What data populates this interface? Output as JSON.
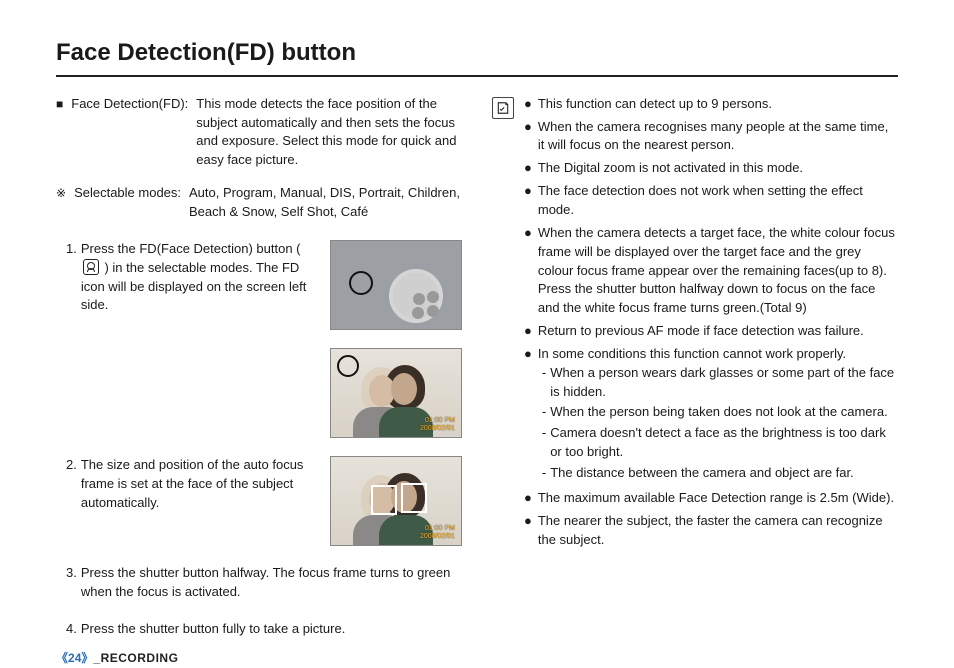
{
  "title": "Face Detection(FD) button",
  "intro": {
    "bullet": "■",
    "label": "Face Detection(FD):",
    "text": "This mode detects the face position of the subject automatically and then sets the focus and exposure. Select this mode for quick and easy face picture."
  },
  "modes": {
    "symbol": "※",
    "label": "Selectable modes:",
    "text": "Auto, Program, Manual, DIS, Portrait, Children, Beach & Snow, Self Shot, Café"
  },
  "steps": [
    {
      "num": "1.",
      "text_pre": "Press the FD(Face Detection) button ( ",
      "text_post": " ) in the selectable modes. The FD icon will be displayed on the screen left side.",
      "img_type": "camera"
    },
    {
      "num": "",
      "text_pre": "",
      "text_post": "",
      "img_type": "photo1"
    },
    {
      "num": "2.",
      "text_pre": "The size and position of the auto focus frame is set at the face of the subject automatically.",
      "text_post": "",
      "img_type": "photo2"
    },
    {
      "num": "3.",
      "text_pre": "Press the shutter button halfway. The focus frame turns to green when the focus is activated.",
      "text_post": "",
      "img_type": "none"
    },
    {
      "num": "4.",
      "text_pre": "Press the shutter button fully to take a picture.",
      "text_post": "",
      "img_type": "none"
    }
  ],
  "timestamp_line1": "01:00 PM",
  "timestamp_line2": "2008/02/01",
  "notes": [
    {
      "text": "This function can detect up to 9 persons."
    },
    {
      "text": "When the camera recognises many people at the same time, it will focus on the nearest person."
    },
    {
      "text": "The Digital zoom is not activated in this mode."
    },
    {
      "text": "The face detection does not work when setting the effect mode."
    },
    {
      "text": "When the camera detects a target face, the white colour focus frame will be displayed over the target face and the grey colour focus frame appear over the remaining faces(up to 8). Press the shutter button halfway down to focus on the face and the white focus frame turns green.(Total 9)"
    },
    {
      "text": "Return to previous AF mode if face detection was failure."
    },
    {
      "text": "In some conditions this function cannot work properly.",
      "sub": [
        "When a person wears dark glasses or some part of the face is hidden.",
        "When the person being taken does not look at the camera.",
        "Camera doesn't detect a face as the brightness is too dark or too bright.",
        "The distance between the camera and object are far."
      ]
    },
    {
      "text": "The maximum available Face Detection range is 2.5m (Wide)."
    },
    {
      "text": "The nearer the subject, the faster the camera can recognize the subject."
    }
  ],
  "footer": {
    "page": "24",
    "section": "_RECORDING"
  }
}
